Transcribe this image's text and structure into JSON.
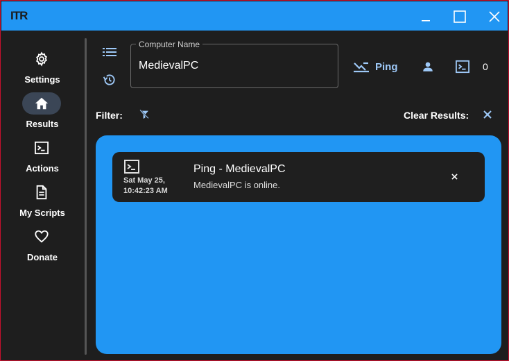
{
  "window": {
    "logo_text": "ITR",
    "accent_color": "#2196f3",
    "border_color": "#c8102e"
  },
  "sidebar": {
    "items": [
      {
        "label": "Settings",
        "icon": "gear-icon"
      },
      {
        "label": "Results",
        "icon": "home-icon",
        "active": true
      },
      {
        "label": "Actions",
        "icon": "terminal-icon"
      },
      {
        "label": "My Scripts",
        "icon": "document-icon"
      },
      {
        "label": "Donate",
        "icon": "heart-icon"
      }
    ]
  },
  "toolbar": {
    "computer_name_label": "Computer Name",
    "computer_name_value": "MedievalPC",
    "ping_label": "Ping",
    "session_count": "0"
  },
  "filters": {
    "filter_label": "Filter:",
    "clear_label": "Clear Results:"
  },
  "results": [
    {
      "date_line1": "Sat May 25,",
      "date_line2": "10:42:23 AM",
      "title": "Ping - MedievalPC",
      "message": "MedievalPC is online."
    }
  ]
}
